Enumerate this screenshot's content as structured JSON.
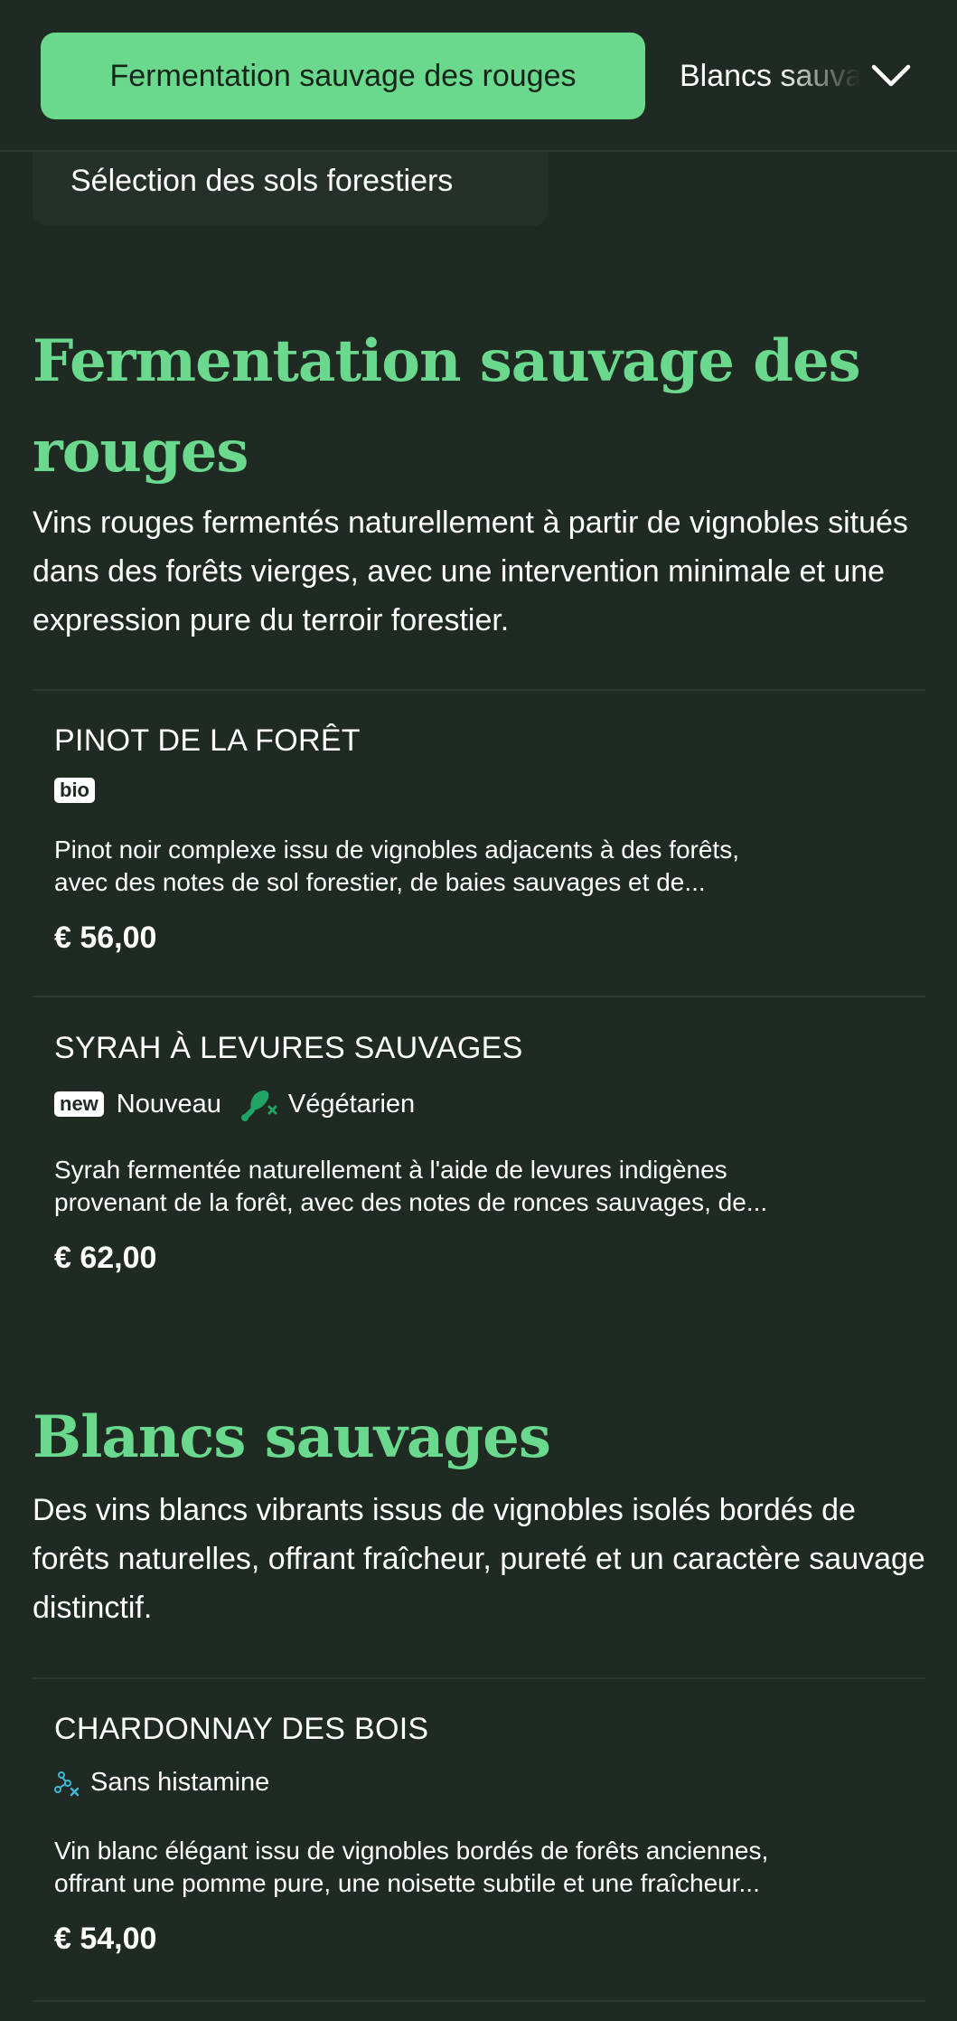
{
  "category_bar": {
    "active_label": "Fermentation sauvage des rouges",
    "next_label": "Blancs sauvages",
    "previous_label": "Sélection des sols forestiers"
  },
  "sections": [
    {
      "title": "Fermentation sauvage des rouges",
      "description": "Vins rouges fermentés naturellement à partir de vignobles situés dans des forêts vierges, avec une intervention minimale et une expression pure du terroir forestier.",
      "items": [
        {
          "name": "PINOT DE LA FORÊT",
          "badge": "bio",
          "desc_line1": "Pinot noir complexe issu de vignobles adjacents à des forêts,",
          "desc_line2": "avec des notes de sol forestier, de baies sauvages et de...",
          "price": "€ 56,00"
        },
        {
          "name": "SYRAH À LEVURES SAUVAGES",
          "badge": "new",
          "tag1": "Nouveau",
          "tag2": "Végétarien",
          "desc_line1": "Syrah fermentée naturellement à l'aide de levures indigènes",
          "desc_line2": "provenant de la forêt, avec des notes de ronces sauvages, de...",
          "price": "€ 62,00"
        }
      ]
    },
    {
      "title": "Blancs sauvages",
      "description": "Des vins blancs vibrants issus de vignobles isolés bordés de forêts naturelles, offrant fraîcheur, pureté et un caractère sauvage distinctif.",
      "items": [
        {
          "name": "CHARDONNAY DES BOIS",
          "tag1": "Sans histamine",
          "desc_line1": "Vin blanc élégant issu de vignobles bordés de forêts anciennes,",
          "desc_line2": "offrant une pomme pure, une noisette subtile et une fraîcheur...",
          "price": "€ 54,00"
        }
      ]
    }
  ],
  "colors": {
    "background": "#1f2a22",
    "accent": "#6bd98d",
    "divider": "#2c3830",
    "vegetarian_icon": "#20a466",
    "histamine_icon": "#3fb8d8"
  },
  "icons": {
    "dropdown": "chevron-down-icon",
    "vegetarian": "drumstick-crossed-icon",
    "histamine": "molecule-crossed-icon"
  }
}
